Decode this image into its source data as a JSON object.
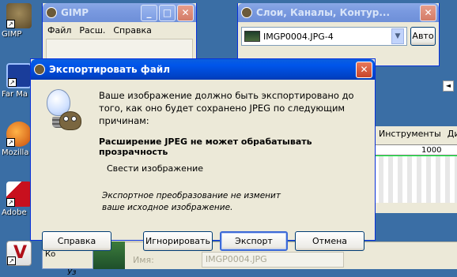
{
  "desktop_icons": [
    {
      "label": "GIMP",
      "color": "#7a6640"
    },
    {
      "label": "Far Ma",
      "color": "#1a3d9a"
    },
    {
      "label": "Mozilla",
      "color": "#e06a1a"
    },
    {
      "label": "Adobe",
      "color": "#c8101e"
    },
    {
      "label": "",
      "color": "#b0101a"
    }
  ],
  "gimp_toolbox": {
    "title": "GIMP",
    "menu": {
      "file": "Файл",
      "ext": "Расш.",
      "help": "Справка"
    }
  },
  "layers_window": {
    "title": "Слои, Каналы, Контур...",
    "image_name": "IMGP0004.JPG-4",
    "auto_label": "Авто"
  },
  "image_window": {
    "menu_tools": "Инструменты",
    "menu_dialogs": "Ди",
    "ruler_value": "1000"
  },
  "bottom_panel": {
    "name_label": "Имя:",
    "name_value": "IMGP0004.JPG",
    "left_strip_title": "Яркость-Ко",
    "left_strip_sub": "Уз"
  },
  "export_dialog": {
    "title": "Экспортировать файл",
    "message": "Ваше изображение должно быть экспортировано до того, как оно будет сохранено JPEG по следующим причинам:",
    "reason": "Расширение JPEG не может обрабатывать прозрачность",
    "option": "Свести изображение",
    "note": "Экспортное преобразование не изменит ваше исходное изображение.",
    "buttons": {
      "help": "Справка",
      "ignore": "Игнорировать",
      "export": "Экспорт",
      "cancel": "Отмена"
    }
  },
  "colors": {
    "desktop": "#3a6ea5",
    "title_active": "#0055ea",
    "window_bg": "#ece9d8"
  }
}
